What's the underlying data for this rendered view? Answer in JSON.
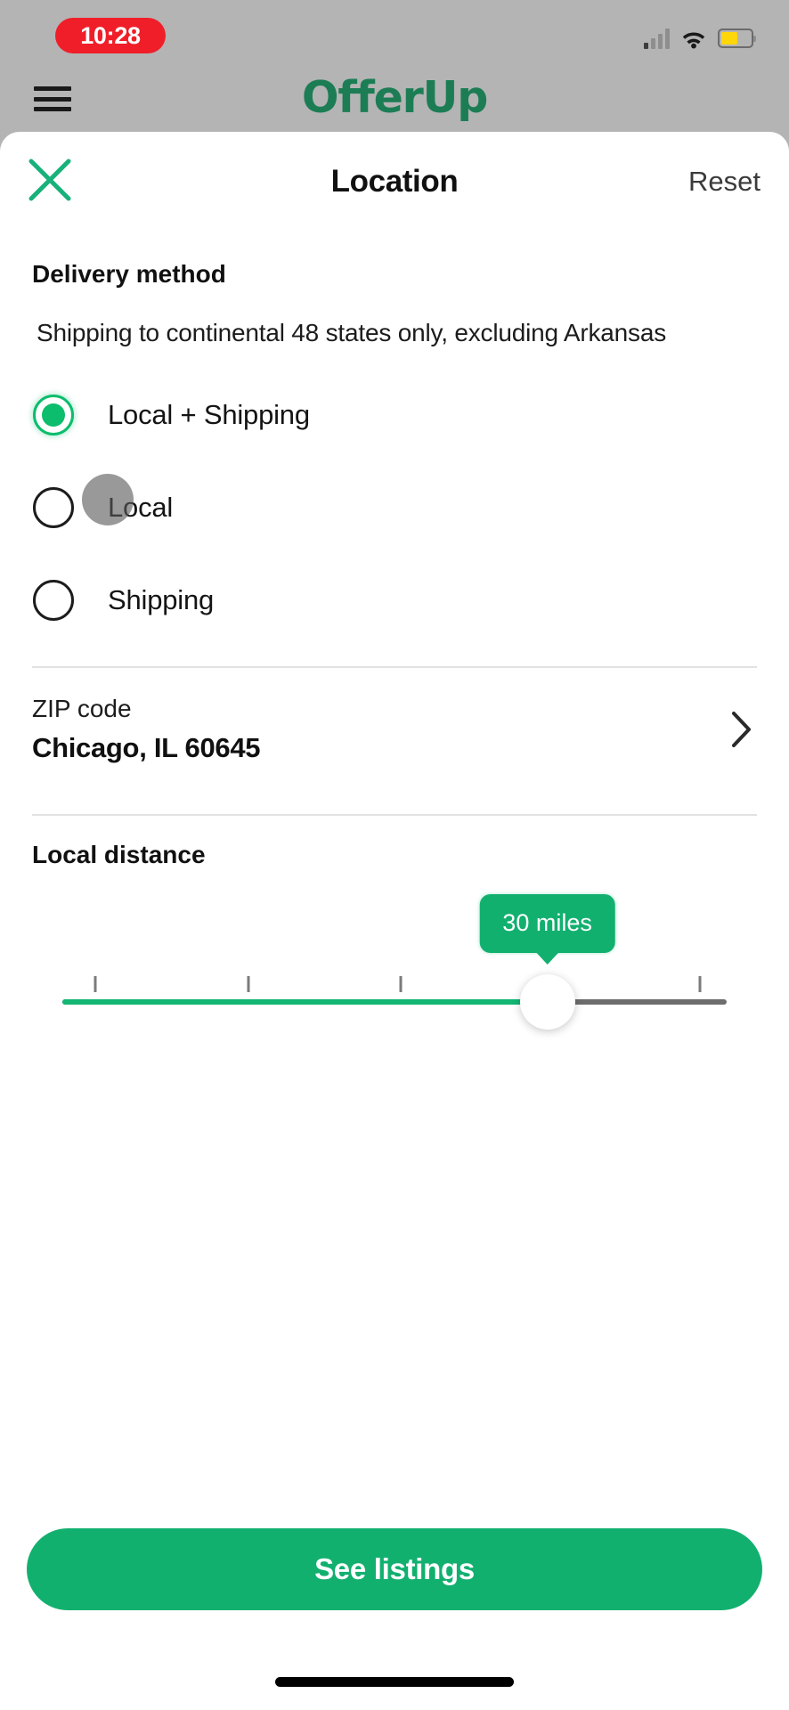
{
  "status_bar": {
    "time": "10:28",
    "signal_icon": "cellular-signal-icon",
    "wifi_icon": "wifi-icon",
    "battery_icon": "battery-icon",
    "battery_level_pct": 55
  },
  "app_header": {
    "menu_icon": "hamburger-menu-icon",
    "brand": "OfferUp",
    "brand_color": "#1c7d55"
  },
  "sheet": {
    "close_icon": "close-x-icon",
    "title": "Location",
    "reset_label": "Reset"
  },
  "delivery": {
    "section_title": "Delivery method",
    "note": "Shipping to continental 48 states only, excluding Arkansas",
    "options": [
      {
        "label": "Local + Shipping",
        "selected": true
      },
      {
        "label": "Local",
        "selected": false
      },
      {
        "label": "Shipping",
        "selected": false
      }
    ]
  },
  "zip": {
    "label": "ZIP code",
    "value": "Chicago, IL 60645",
    "chevron_icon": "chevron-right-icon"
  },
  "distance": {
    "title": "Local distance",
    "bubble_value": "30 miles",
    "value": 30,
    "min": 0,
    "max": 50,
    "fill_pct": 73,
    "ticks_pct": [
      5,
      28,
      51,
      96
    ]
  },
  "cta": {
    "label": "See listings"
  },
  "colors": {
    "brand_green": "#12b06f",
    "accent_green": "#0bbd6d",
    "status_red": "#f01e28",
    "battery_yellow": "#ffd60a"
  }
}
